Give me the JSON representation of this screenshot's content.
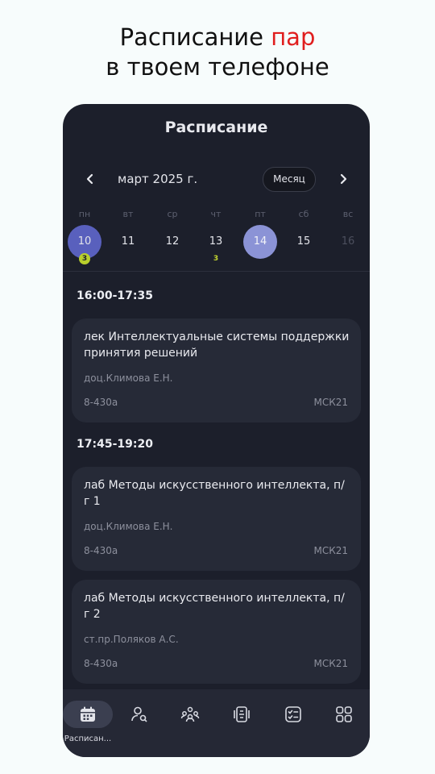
{
  "promo": {
    "line1_prefix": "Расписание ",
    "line1_accent": "пар",
    "line2": "в твоем телефоне",
    "accent_color": "#e01e1e"
  },
  "app": {
    "title": "Расписание",
    "month_label": "март 2025 г.",
    "month_button": "Месяц",
    "prev_icon": "chevron-left-icon",
    "next_icon": "chevron-right-icon"
  },
  "calendar": {
    "weekdays": [
      "пн",
      "вт",
      "ср",
      "чт",
      "пт",
      "сб",
      "вс"
    ],
    "days": [
      {
        "num": "10",
        "state": "selected",
        "badge": "3"
      },
      {
        "num": "11",
        "state": "normal",
        "badge": ""
      },
      {
        "num": "12",
        "state": "normal",
        "badge": ""
      },
      {
        "num": "13",
        "state": "normal",
        "mark": "3"
      },
      {
        "num": "14",
        "state": "today",
        "badge": ""
      },
      {
        "num": "15",
        "state": "normal",
        "badge": ""
      },
      {
        "num": "16",
        "state": "muted",
        "badge": ""
      }
    ]
  },
  "schedule": [
    {
      "time": "16:00-17:35",
      "lessons": [
        {
          "subject": "лек Интеллектуальные системы поддержки принятия решений",
          "teacher": "доц.Климова Е.Н.",
          "room": "8-430а",
          "tz": "МСК21"
        }
      ]
    },
    {
      "time": "17:45-19:20",
      "lessons": [
        {
          "subject": "лаб Методы искусственного интеллекта, п/г 1",
          "teacher": "доц.Климова Е.Н.",
          "room": "8-430а",
          "tz": "МСК21"
        },
        {
          "subject": "лаб Методы искусственного интеллекта, п/г 2",
          "teacher": "ст.пр.Поляков А.С.",
          "room": "8-430а",
          "tz": "МСК21"
        }
      ]
    }
  ],
  "nav": {
    "items": [
      {
        "icon": "calendar-icon",
        "label": "Расписан...",
        "active": true
      },
      {
        "icon": "person-search-icon",
        "label": "",
        "active": false
      },
      {
        "icon": "group-icon",
        "label": "",
        "active": false
      },
      {
        "icon": "id-card-icon",
        "label": "",
        "active": false
      },
      {
        "icon": "checklist-icon",
        "label": "",
        "active": false
      },
      {
        "icon": "grid-icon",
        "label": "",
        "active": false
      }
    ]
  }
}
